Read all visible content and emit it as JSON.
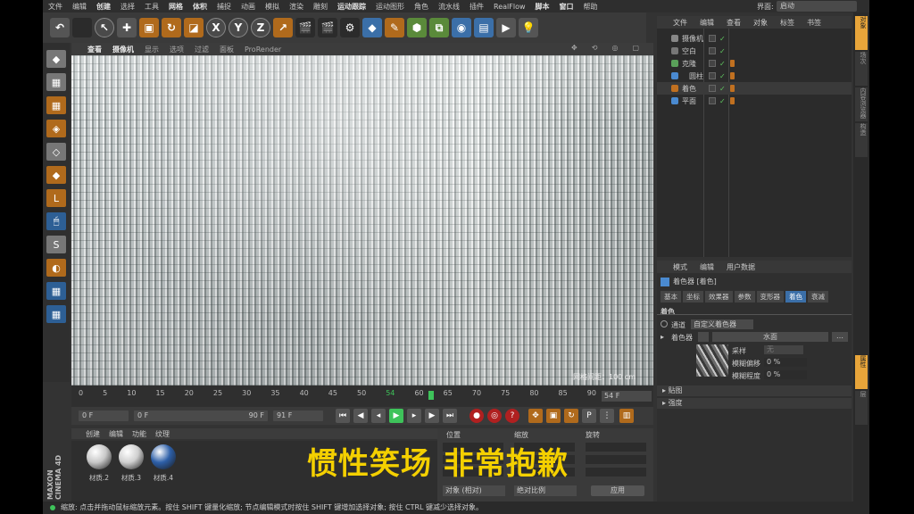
{
  "menu": [
    "文件",
    "编辑",
    "创建",
    "选择",
    "工具",
    "网格",
    "体积",
    "捕捉",
    "动画",
    "模拟",
    "渲染",
    "雕刻",
    "运动跟踪",
    "运动图形",
    "角色",
    "流水线",
    "插件",
    "RealFlow",
    "脚本",
    "窗口",
    "帮助"
  ],
  "layout": {
    "label": "界面:",
    "value": "启动"
  },
  "view_tabs": [
    "查看",
    "摄像机",
    "显示",
    "选项",
    "过滤",
    "面板",
    "ProRender"
  ],
  "viewport": {
    "grid_scale": "网格间距：100 cm"
  },
  "timeline": {
    "ticks": [
      "0",
      "5",
      "10",
      "15",
      "20",
      "25",
      "30",
      "35",
      "40",
      "45",
      "50",
      "54",
      "60",
      "65",
      "70",
      "75",
      "80",
      "85",
      "90"
    ],
    "current_frame": "54 F"
  },
  "transport": {
    "start": "0 F",
    "range_start": "0 F",
    "range_end": "90 F",
    "end": "91 F"
  },
  "materials": {
    "tabs": [
      "创建",
      "编辑",
      "功能",
      "纹理"
    ],
    "items": [
      {
        "name": "材质.2",
        "color": "#c8c8c8"
      },
      {
        "name": "材质.3",
        "color": "#d0d0d0"
      },
      {
        "name": "材质.4",
        "color": "#2d5fa8"
      }
    ]
  },
  "coords": {
    "headers": [
      "位置",
      "缩放",
      "旋转"
    ],
    "mode": "对象 (相对)",
    "scale_mode": "绝对比例",
    "apply": "应用"
  },
  "status": "缩放: 点击并拖动鼠标缩放元素。按住 SHIFT 键量化缩放; 节点编辑模式时按住 SHIFT 键增加选择对象; 按住 CTRL 键减少选择对象。",
  "objects": {
    "tabs": [
      "文件",
      "编辑",
      "查看",
      "对象",
      "标签",
      "书签"
    ],
    "rows": [
      {
        "name": "摄像机",
        "color": "#888"
      },
      {
        "name": "空白",
        "color": "#777"
      },
      {
        "name": "克隆",
        "color": "#5aa05a"
      },
      {
        "name": "圆柱",
        "color": "#4a8ad0"
      },
      {
        "name": "着色",
        "color": "#c07020"
      },
      {
        "name": "平面",
        "color": "#4a8ad0"
      }
    ]
  },
  "attributes": {
    "tabs": [
      "模式",
      "编辑",
      "用户数据"
    ],
    "title": "着色器 [着色]",
    "subtabs": [
      "基本",
      "坐标",
      "效果器",
      "参数",
      "变形器",
      "着色",
      "衰减"
    ],
    "section": "着色",
    "channel_label": "通道",
    "channel_value": "自定义着色器",
    "shader_label": "着色器",
    "shader_value": "水面",
    "sample_label": "采样",
    "sample_value": "无",
    "blur_offset_label": "模糊偏移",
    "blur_offset_value": "0 %",
    "blur_amount_label": "模糊程度",
    "blur_amount_value": "0 %",
    "groups": [
      "贴图",
      "强度"
    ]
  },
  "right_tabs": [
    "对象",
    "场次",
    "内容浏览器",
    "构造",
    "属性",
    "层"
  ],
  "subtitle": "惯性笑场 非常抱歉"
}
